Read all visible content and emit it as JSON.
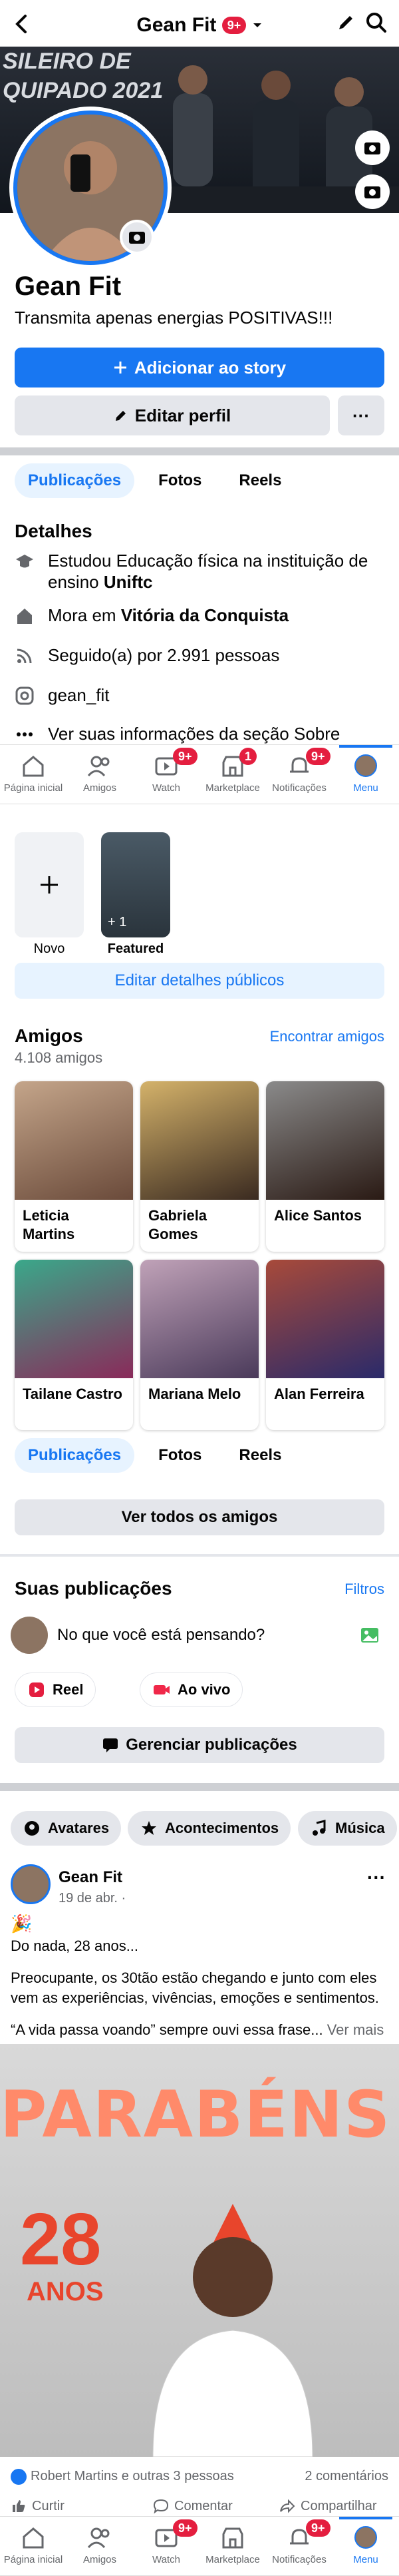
{
  "header": {
    "title": "Gean Fit",
    "notification_count": "9+"
  },
  "cover": {
    "text_line1": "SILEIRO DE",
    "text_line2": "QUIPADO 2021"
  },
  "profile": {
    "name": "Gean Fit",
    "bio": "Transmita apenas energias POSITIVAS!!!",
    "add_story_label": "Adicionar ao story",
    "edit_profile_label": "Editar perfil",
    "more_label": "···"
  },
  "profile_tabs": [
    "Publicações",
    "Fotos",
    "Reels"
  ],
  "details": {
    "title": "Detalhes",
    "education": "Estudou Educação física na instituição de ensino ",
    "education_place": "Uniftc",
    "lives_prefix": "Mora em ",
    "lives_place": "Vitória da Conquista",
    "followers": "Seguido(a) por 2.991 pessoas",
    "instagram": "gean_fit",
    "about_link": "Ver suas informações da seção Sobre"
  },
  "bottom_nav": {
    "items": [
      {
        "label": "Página inicial",
        "icon": "home-icon",
        "badge": ""
      },
      {
        "label": "Amigos",
        "icon": "friends-icon",
        "badge": ""
      },
      {
        "label": "Watch",
        "icon": "watch-icon",
        "badge": "9+"
      },
      {
        "label": "Marketplace",
        "icon": "marketplace-icon",
        "badge": "1"
      },
      {
        "label": "Notificações",
        "icon": "bell-icon",
        "badge": "9+"
      },
      {
        "label": "Menu",
        "icon": "menu-avatar-icon",
        "badge": ""
      }
    ]
  },
  "highlights": {
    "new_label": "Novo",
    "featured_label": "Featured",
    "featured_count": "+ 1",
    "edit_public_label": "Editar detalhes públicos"
  },
  "friends": {
    "title": "Amigos",
    "count": "4.108 amigos",
    "find_label": "Encontrar amigos",
    "see_all_label": "Ver todos os amigos",
    "list": [
      {
        "name": "Leticia Martins"
      },
      {
        "name": "Gabriela Gomes"
      },
      {
        "name": "Alice Santos"
      },
      {
        "name": "Tailane Castro"
      },
      {
        "name": "Mariana Melo"
      },
      {
        "name": "Alan Ferreira"
      }
    ]
  },
  "posts_section": {
    "title": "Suas publicações",
    "filters_label": "Filtros",
    "composer_placeholder": "No que você está pensando?",
    "reel_label": "Reel",
    "live_label": "Ao vivo",
    "manage_label": "Gerenciar publicações"
  },
  "chips": [
    "Avatares",
    "Acontecimentos",
    "Música"
  ],
  "post": {
    "author": "Gean Fit",
    "date": "19 de abr. ·",
    "line1": "Do nada, 28 anos...",
    "line2": "Preocupante, os 30tão estão chegando e junto com eles vem as experiências, vivências, emoções e sentimentos.",
    "line3": "“A vida passa voando” sempre ouvi essa frase...",
    "see_more": "Ver mais",
    "image_title": "PARABÉNS!",
    "image_age": "28",
    "image_age_label": "ANOS",
    "reactions": "Robert Martins e outras 3 pessoas",
    "comments": "2 comentários",
    "like_label": "Curtir",
    "comment_label": "Comentar",
    "share_label": "Compartilhar"
  }
}
